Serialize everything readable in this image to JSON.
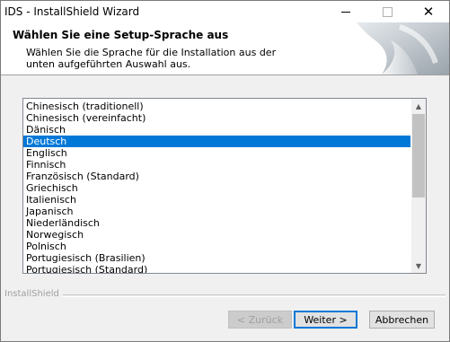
{
  "window": {
    "title": "IDS - InstallShield Wizard",
    "close_glyph": "✕"
  },
  "header": {
    "title": "Wählen Sie eine Setup-Sprache aus",
    "description": "Wählen Sie die Sprache für die Installation aus der unten aufgeführten Auswahl aus."
  },
  "language_list": {
    "selected": "Deutsch",
    "items": [
      "Chinesisch (traditionell)",
      "Chinesisch (vereinfacht)",
      "Dänisch",
      "Deutsch",
      "Englisch",
      "Finnisch",
      "Französisch (Standard)",
      "Griechisch",
      "Italienisch",
      "Japanisch",
      "Niederländisch",
      "Norwegisch",
      "Polnisch",
      "Portugiesisch (Brasilien)",
      "Portugiesisch (Standard)"
    ],
    "scroll_up_glyph": "▲",
    "scroll_down_glyph": "▼"
  },
  "footer": {
    "brand": "InstallShield",
    "back_label": "< Zurück",
    "next_label": "Weiter >",
    "cancel_label": "Abbrechen"
  },
  "colors": {
    "selection": "#0078d7",
    "dialog_bg": "#f0f0f0"
  },
  "icons": {
    "header_graphic": "installshield-page-curl-icon",
    "minimize": "minimize-icon",
    "maximize": "maximize-icon",
    "close": "close-icon"
  }
}
